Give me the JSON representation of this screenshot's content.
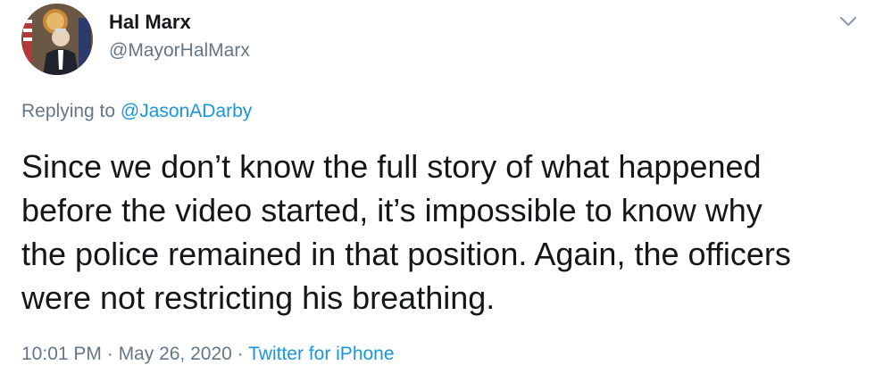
{
  "author": {
    "name": "Hal Marx",
    "handle": "@MayorHalMarx"
  },
  "reply": {
    "prefix": "Replying to ",
    "to_handle": "@JasonADarby"
  },
  "tweet": {
    "text": "Since we don’t know the full story of what happened\nbefore the video started, it’s impossible to know why\nthe police remained in that position. Again, the officers\nwere not restricting his breathing."
  },
  "meta": {
    "time": "10:01 PM",
    "sep1": " · ",
    "date": "May 26, 2020",
    "sep2": " · ",
    "source": "Twitter for iPhone"
  },
  "icons": {
    "menu": "chevron-down-icon"
  },
  "colors": {
    "link": "#1b95e0",
    "secondary_text": "#657786",
    "primary_text": "#14171a"
  }
}
